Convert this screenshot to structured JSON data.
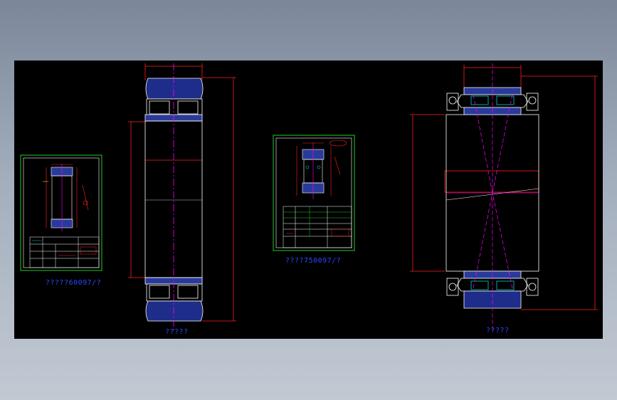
{
  "canvas": {
    "background": "#000000",
    "colors": {
      "dimension": "#ff2020",
      "outline": "#ffffff",
      "center": "#ff00ff",
      "section_fill": "#2a3a9a",
      "frame": "#22cc22",
      "label": "#2a48ff",
      "cyan": "#00d0d0",
      "yellow": "#e0e000"
    }
  },
  "labels": {
    "sheet_1": "?????60097/?",
    "sheet_2": "????750097/?",
    "view_1": "?????",
    "view_2": "?????"
  },
  "icons": {
    "cross_section": "bearing-section-drawing",
    "title_block": "title-block-table"
  }
}
